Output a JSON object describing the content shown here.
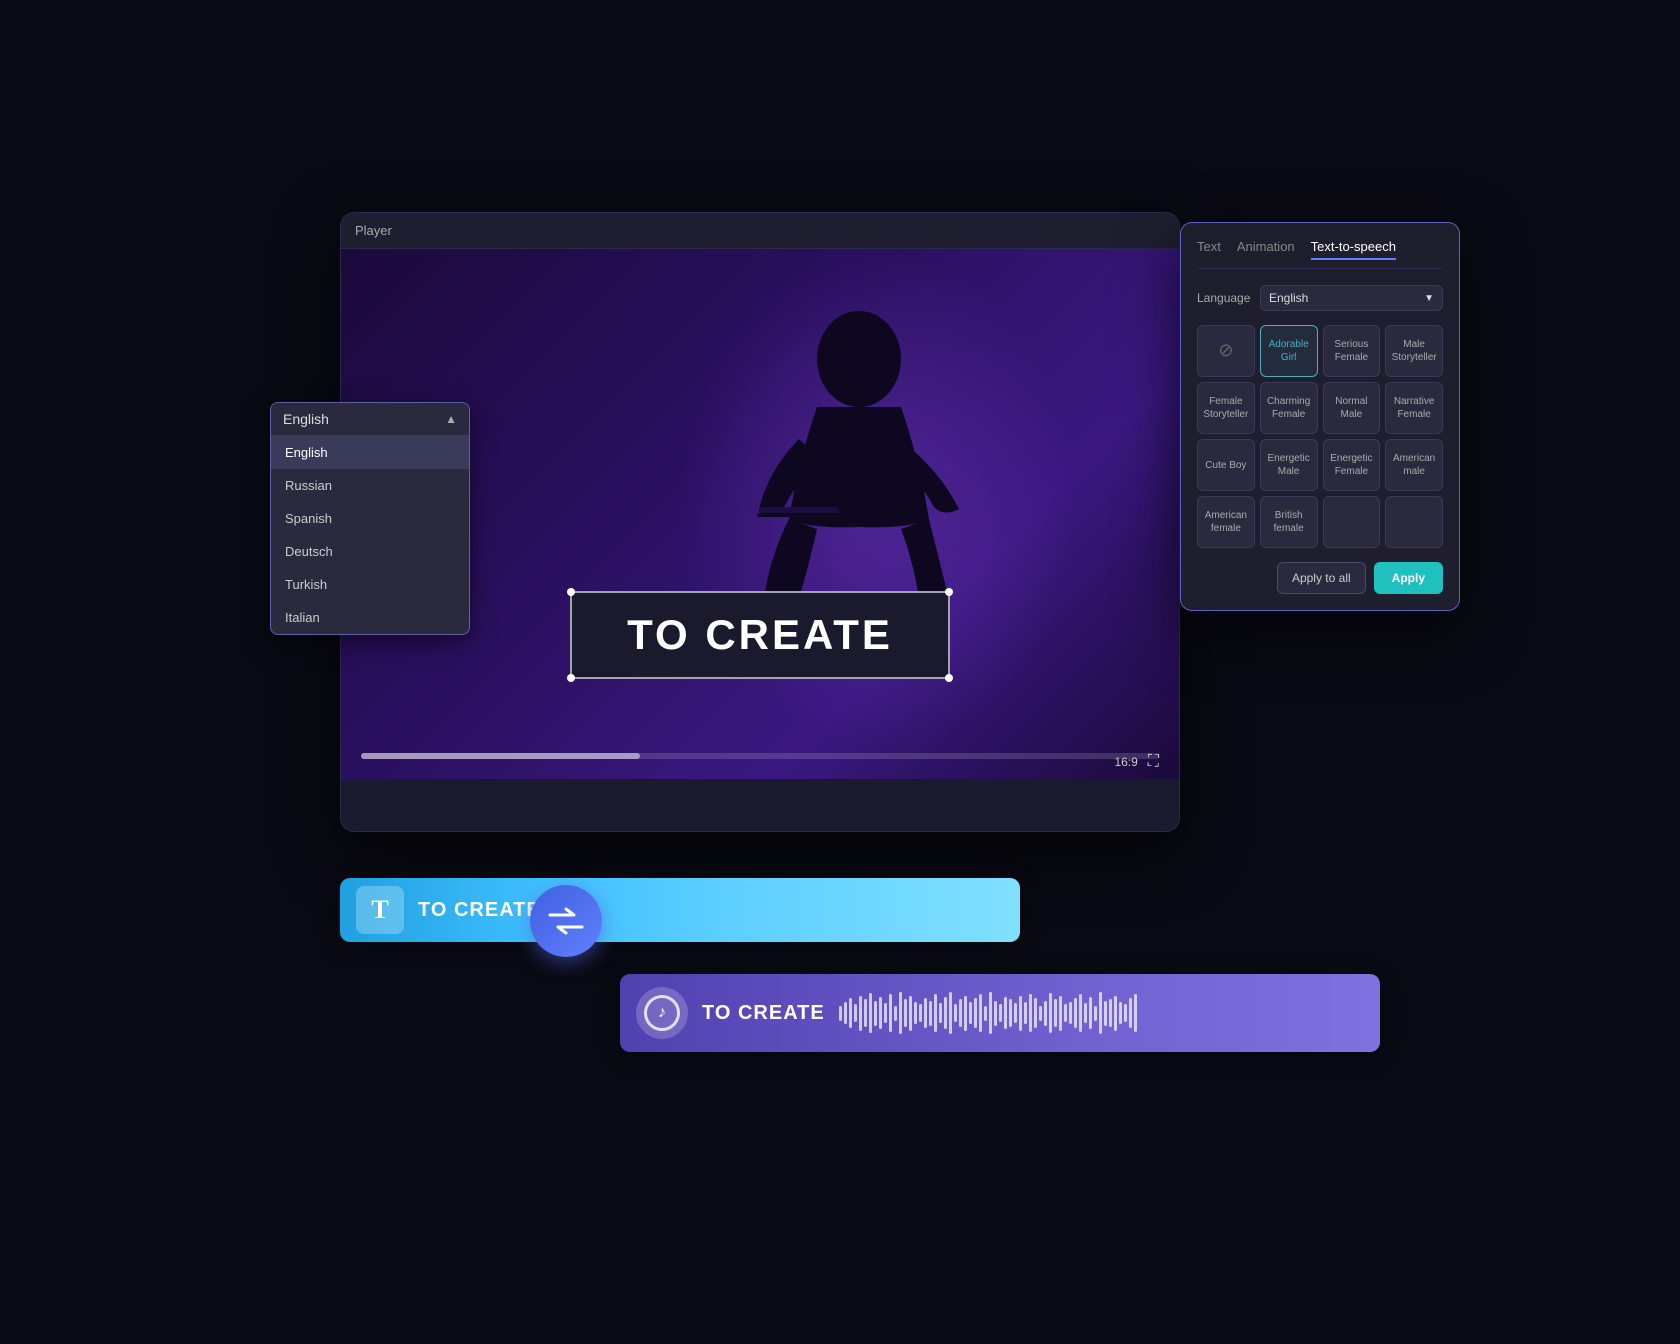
{
  "player": {
    "title": "Player",
    "overlay_text": "TO CREATE",
    "aspect_ratio": "16:9"
  },
  "language_dropdown": {
    "header": "English",
    "items": [
      {
        "label": "English",
        "selected": true
      },
      {
        "label": "Russian",
        "selected": false
      },
      {
        "label": "Spanish",
        "selected": false
      },
      {
        "label": "Deutsch",
        "selected": false
      },
      {
        "label": "Turkish",
        "selected": false
      },
      {
        "label": "Italian",
        "selected": false
      }
    ]
  },
  "tts_panel": {
    "tabs": [
      "Text",
      "Animation",
      "Text-to-speech"
    ],
    "active_tab": "Text-to-speech",
    "language_label": "Language",
    "language_value": "English",
    "voices": [
      {
        "id": "none",
        "label": "",
        "type": "none"
      },
      {
        "id": "adorable-girl",
        "label": "Adorable Girl",
        "selected": true
      },
      {
        "id": "serious-female",
        "label": "Serious Female"
      },
      {
        "id": "male-storyteller",
        "label": "Male Storyteller"
      },
      {
        "id": "female-storyteller",
        "label": "Female Storyteller"
      },
      {
        "id": "charming-female",
        "label": "Charming Female"
      },
      {
        "id": "normal-male",
        "label": "Normal Male"
      },
      {
        "id": "narrative-female",
        "label": "Narrative Female"
      },
      {
        "id": "cute-boy",
        "label": "Cute Boy"
      },
      {
        "id": "energetic-male",
        "label": "Energetic Male"
      },
      {
        "id": "energetic-female",
        "label": "Energetic Female"
      },
      {
        "id": "american-male",
        "label": "American male"
      },
      {
        "id": "american-female",
        "label": "American female"
      },
      {
        "id": "british-female",
        "label": "British female"
      }
    ],
    "btn_apply_all": "Apply to all",
    "btn_apply": "Apply"
  },
  "timeline": {
    "text_track_label": "TO CREATE",
    "audio_track_label": "TO CREATE",
    "t_icon": "T"
  },
  "transfer_icon": "⇆"
}
